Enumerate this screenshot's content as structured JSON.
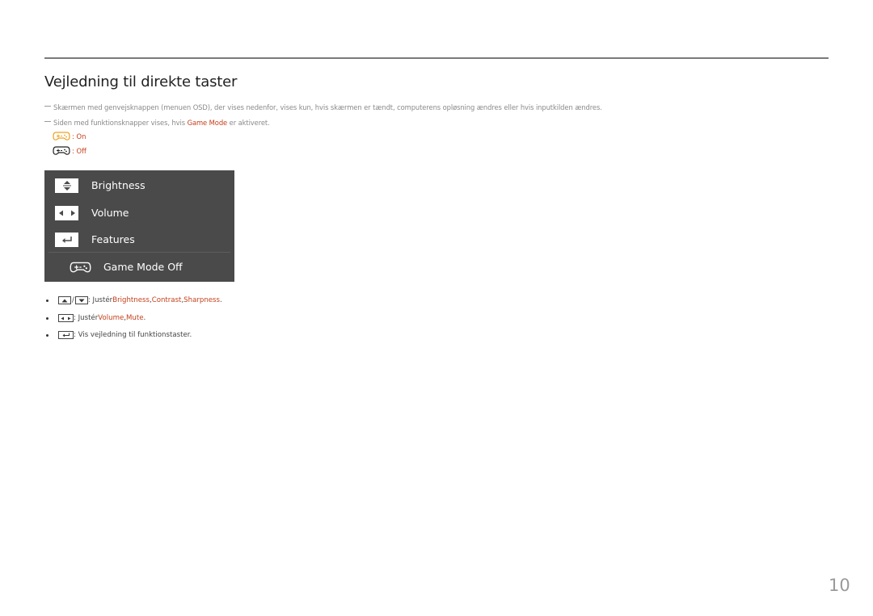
{
  "page": {
    "title": "Vejledning til direkte taster",
    "page_number": "10"
  },
  "notes": [
    {
      "text": "Skærmen med genvejsknappen (menuen OSD), der vises nedenfor, vises kun, hvis skærmen er tændt, computerens opløsning ændres eller hvis inputkilden ændres."
    },
    {
      "before": "Siden med funktionsknapper vises, hvis ",
      "highlight": "Game Mode",
      "after": " er aktiveret."
    }
  ],
  "legend": {
    "on_label": ": On",
    "off_label": ": Off",
    "on_color": "#f0a020",
    "off_color": "#222222"
  },
  "osd_menu": {
    "items": [
      {
        "icon": "up-down-arrows-icon",
        "label": "Brightness"
      },
      {
        "icon": "left-right-arrows-icon",
        "label": "Volume"
      },
      {
        "icon": "enter-icon",
        "label": "Features"
      }
    ],
    "game_mode_label": "Game Mode Off",
    "background": "#4a4a4a"
  },
  "bullets": [
    {
      "prefix": ": Justér ",
      "links": [
        "Brightness",
        "Contrast",
        "Sharpness"
      ],
      "sep": ", ",
      "suffix": "."
    },
    {
      "prefix": ": Justér ",
      "links": [
        "Volume",
        "Mute"
      ],
      "sep": ", ",
      "suffix": "."
    },
    {
      "prefix": ": Vis vejledning til funktionstaster.",
      "links": [],
      "sep": "",
      "suffix": ""
    }
  ],
  "accent_color": "#c4401c"
}
